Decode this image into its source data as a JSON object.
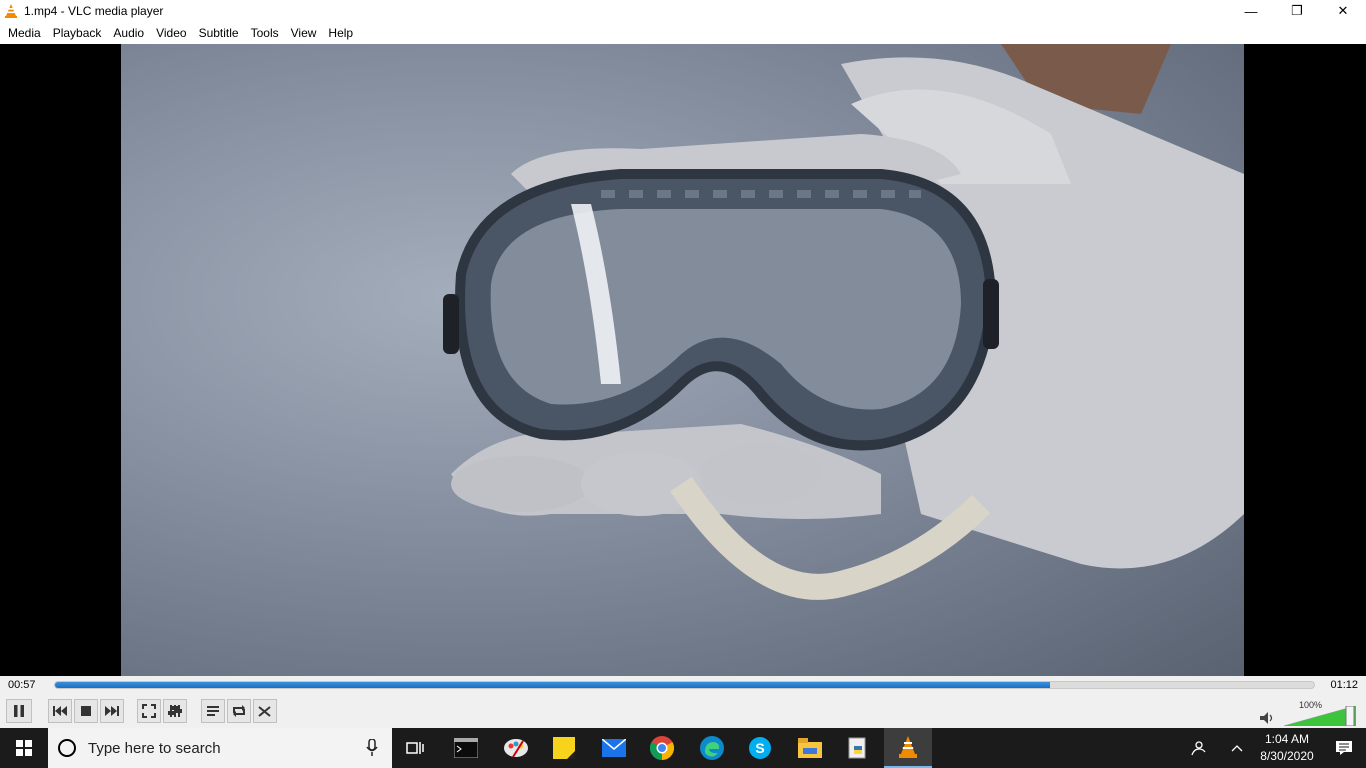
{
  "window": {
    "title": "1.mp4 - VLC media player",
    "minimize_glyph": "—",
    "restore_glyph": "❐",
    "close_glyph": "✕"
  },
  "menu": [
    "Media",
    "Playback",
    "Audio",
    "Video",
    "Subtitle",
    "Tools",
    "View",
    "Help"
  ],
  "player": {
    "elapsed": "00:57",
    "total": "01:12",
    "progress_fraction": 0.79,
    "volume_percent": "100%",
    "volume_fraction": 1.0,
    "accent_color": "#1c6fc4"
  },
  "controls": [
    "pause-icon",
    "previous-icon",
    "stop-icon",
    "next-icon",
    "fullscreen-icon",
    "extended-settings-icon",
    "playlist-icon",
    "loop-icon",
    "shuffle-icon"
  ],
  "taskbar": {
    "search_placeholder": "Type here to search",
    "icons": [
      "task-view-icon",
      "terminal-icon",
      "paint-icon",
      "sticky-notes-icon",
      "mail-icon",
      "chrome-icon",
      "edge-icon",
      "skype-icon",
      "file-explorer-icon",
      "python-icon",
      "vlc-icon"
    ],
    "time": "1:04 AM",
    "date": "8/30/2020"
  }
}
